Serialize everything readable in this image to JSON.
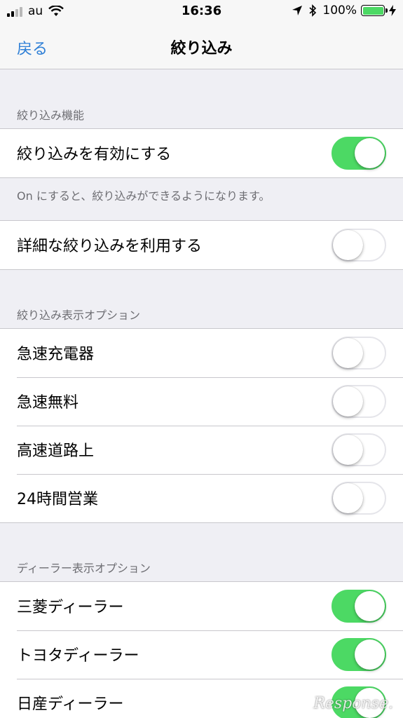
{
  "status_bar": {
    "carrier": "au",
    "time": "16:36",
    "battery": "100%"
  },
  "nav": {
    "back": "戻る",
    "title": "絞り込み"
  },
  "sections": {
    "filter": {
      "header": "絞り込み機能",
      "enable": {
        "label": "絞り込みを有効にする",
        "on": true
      },
      "footer": "On にすると、絞り込みができるようになります。",
      "advanced": {
        "label": "詳細な絞り込みを利用する",
        "on": false
      }
    },
    "display": {
      "header": "絞り込み表示オプション",
      "items": [
        {
          "label": "急速充電器",
          "on": false
        },
        {
          "label": "急速無料",
          "on": false
        },
        {
          "label": "高速道路上",
          "on": false
        },
        {
          "label": "24時間営業",
          "on": false
        }
      ]
    },
    "dealer": {
      "header": "ディーラー表示オプション",
      "items": [
        {
          "label": "三菱ディーラー",
          "on": true
        },
        {
          "label": "トヨタディーラー",
          "on": true
        },
        {
          "label": "日産ディーラー",
          "on": true
        }
      ]
    }
  },
  "watermark": "Response.",
  "colors": {
    "accent": "#2e7fd6",
    "switch_on": "#4cd964",
    "background": "#efeff4"
  }
}
